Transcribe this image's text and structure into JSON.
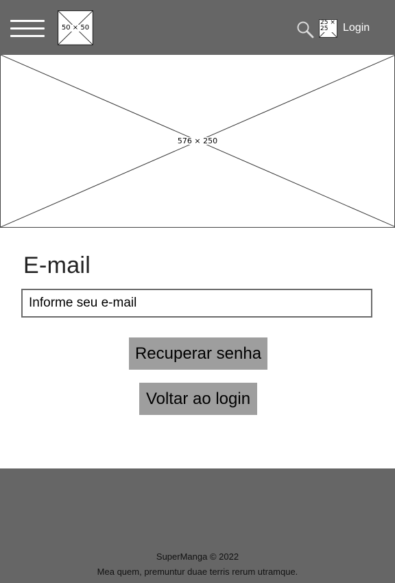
{
  "header": {
    "menu_icon": "hamburger-menu-icon",
    "logo_placeholder": "50 × 50",
    "search_icon": "search-icon",
    "avatar_placeholder": "25 × 25",
    "login_label": "Login"
  },
  "banner": {
    "placeholder": "576 × 250"
  },
  "form": {
    "email_label": "E-mail",
    "email_placeholder": "Informe seu e-mail",
    "email_value": "",
    "recover_button": "Recuperar senha",
    "back_button": "Voltar ao login"
  },
  "footer": {
    "brand": "SuperManga © 2022",
    "tagline": "Mea quem, premuntur duae terris rerum utramque."
  },
  "colors": {
    "header_bg": "#666666",
    "footer_bg": "#666666",
    "button_bg": "#9e9e9e",
    "page_bg": "#ffffff"
  }
}
